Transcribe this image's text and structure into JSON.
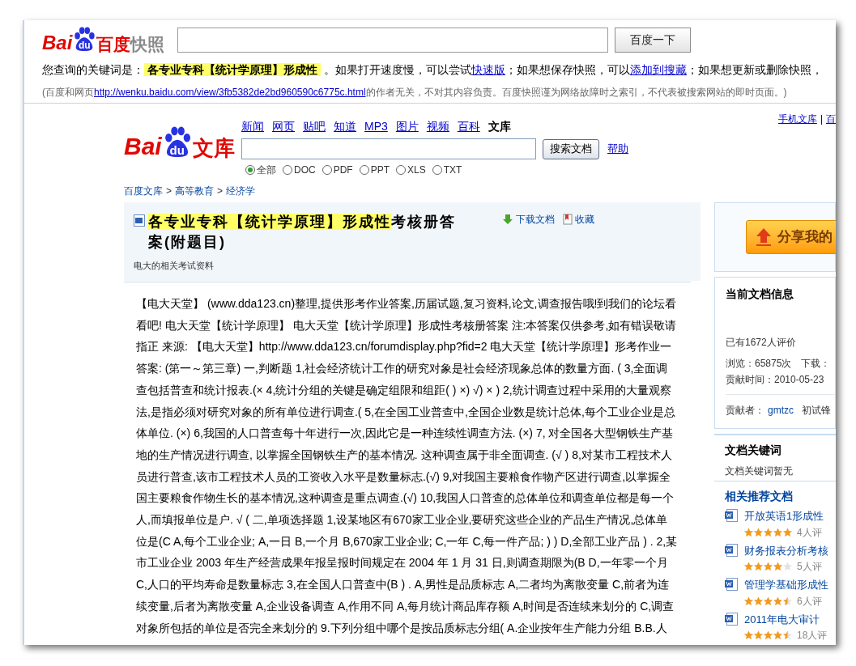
{
  "snapshot_bar": {
    "logo": [
      "Bai",
      "du",
      "百度",
      "快照"
    ],
    "button": "百度一下",
    "notice": [
      {
        "kind": "text",
        "text": "您查询的关键词是："
      },
      {
        "kind": "highlight",
        "text": "各专业专科【统计学原理】形成性"
      },
      {
        "kind": "text",
        "text": " 。如果打开速度慢，可以尝试"
      },
      {
        "kind": "link",
        "text": "快速版"
      },
      {
        "kind": "text",
        "text": "；如果想保存快照，可以"
      },
      {
        "kind": "link",
        "text": "添加到搜藏"
      },
      {
        "kind": "text",
        "text": "；如果想更新或删除快照，"
      }
    ],
    "source": [
      {
        "kind": "text",
        "text": "(百度和网页"
      },
      {
        "kind": "link",
        "text": "http://wenku.baidu.com/view/3fb5382de2bd960590c6775c.html"
      },
      {
        "kind": "text",
        "text": "的作者无关，不对其内容负责。百度快照谨为网络故障时之索引，不代表被搜索网站的即时页面。)"
      }
    ]
  },
  "wenku": {
    "logo": [
      "Bai",
      "du",
      "文库"
    ],
    "nav": [
      {
        "label": "新闻",
        "selected": false
      },
      {
        "label": "网页",
        "selected": false
      },
      {
        "label": "贴吧",
        "selected": false
      },
      {
        "label": "知道",
        "selected": false
      },
      {
        "label": "MP3",
        "selected": false
      },
      {
        "label": "图片",
        "selected": false
      },
      {
        "label": "视频",
        "selected": false
      },
      {
        "label": "百科",
        "selected": false
      },
      {
        "label": "文库",
        "selected": true
      }
    ],
    "search_button": "搜索文档",
    "help": "帮助",
    "filters": [
      {
        "label": "全部",
        "selected": true
      },
      {
        "label": "DOC",
        "selected": false
      },
      {
        "label": "PDF",
        "selected": false
      },
      {
        "label": "PPT",
        "selected": false
      },
      {
        "label": "XLS",
        "selected": false
      },
      {
        "label": "TXT",
        "selected": false
      }
    ],
    "top_links": [
      {
        "kind": "link",
        "text": "手机文库"
      },
      {
        "kind": "sep",
        "text": "|"
      },
      {
        "kind": "link",
        "text": "百"
      }
    ]
  },
  "breadcrumb": [
    {
      "kind": "link",
      "text": "百度文库"
    },
    {
      "kind": "sep",
      "text": ">"
    },
    {
      "kind": "link",
      "text": "高等教育"
    },
    {
      "kind": "sep",
      "text": ">"
    },
    {
      "kind": "link",
      "text": "经济学"
    }
  ],
  "document": {
    "title": [
      {
        "highlight": true,
        "text": "各专业专科【统计学原理】形成性"
      },
      {
        "highlight": false,
        "text": "考核册答案(附题目)"
      }
    ],
    "actions": [
      {
        "kind": "download",
        "label": "下载文档"
      },
      {
        "kind": "favorite",
        "label": "收藏"
      }
    ],
    "subtitle": "电大的相关考试资料",
    "body": "【电大天堂】 (www.dda123.cn)整理,提供形考作业答案,历届试题,复习资料,论文,调查报告哦!到我们的论坛看看吧! 电大天堂【统计学原理】 电大天堂【统计学原理】形成性考核册答案 注:本答案仅供参考,如有错误敬请指正 来源: 【电大天堂】http://www.dda123.cn/forumdisplay.php?fid=2 电大天堂【统计学原理】形考作业一答案: (第一～第三章) 一,判断题 1,社会经济统计工作的研究对象是社会经济现象总体的数量方面. ( 3,全面调查包括普查和统计报表.(× 4,统计分组的关键是确定组限和组距( ) ×) √) × ) 2,统计调查过程中采用的大量观察法,是指必须对研究对象的所有单位进行调查.( 5,在全国工业普查中,全国企业数是统计总体,每个工业企业是总体单位. (×) 6,我国的人口普查每十年进行一次,因此它是一种连续性调查方法. (×) 7, 对全国各大型钢铁生产基地的生产情况进行调查, 以掌握全国钢铁生产的基本情况. 这种调查属于非全面调查. (√ ) 8,对某市工程技术人员进行普查,该市工程技术人员的工资收入水平是数量标志.(√) 9,对我国主要粮食作物产区进行调查,以掌握全国主要粮食作物生长的基本情况,这种调查是重点调查.(√) 10,我国人口普查的总体单位和调查单位都是每一个人,而填报单位是户. √ ( 二,单项选择题 1,设某地区有670家工业企业,要研究这些企业的产品生产情况,总体单位是(C A,每个工业企业; A,一日 B,一个月 B,670家工业企业; C,一年 C,每一件产品; ) ) D,全部工业产品 ) . 2,某市工业企业 2003 年生产经营成果年报呈报时间规定在 2004 年 1 月 31 日,则调查期限为(B D,一年零一个月 C,人口的平均寿命是数量标志 3,在全国人口普查中(B ) . A,男性是品质标志 A,二者均为离散变量 C,前者为连续变量,后者为离散变量 A,企业设备调查 A,作用不同 A,每月统计商品库存额 A,时间是否连续来划分的 C,调查对象所包括的单位是否完全来划分的 9.下列分组中哪个是按品质标志分组( A.企业按年生产能力分组 B.B.人"
  },
  "sidebar": {
    "share_button": "分享我的",
    "info": {
      "heading": "当前文档信息",
      "rating": "已有1672人评价",
      "views": "浏览：65875次",
      "downloads": "下载：",
      "date": "贡献时间：2010-05-23",
      "contributor_label": "贡献者：",
      "contributor": "gmtzc",
      "contributor_level": "初试锋"
    },
    "keywords": {
      "heading": "文档关键词",
      "text": "文档关键词暂无"
    },
    "related": {
      "heading": "相关推荐文档",
      "items": [
        {
          "title": "开放英语1形成性",
          "stars": 5,
          "reviews": "4人评"
        },
        {
          "title": "财务报表分析考核",
          "stars": 4,
          "reviews": "5人评"
        },
        {
          "title": "管理学基础形成性",
          "stars": 4.5,
          "reviews": "6人评"
        },
        {
          "title": "2011年电大审计",
          "stars": 4.5,
          "reviews": "18人评"
        }
      ]
    }
  }
}
